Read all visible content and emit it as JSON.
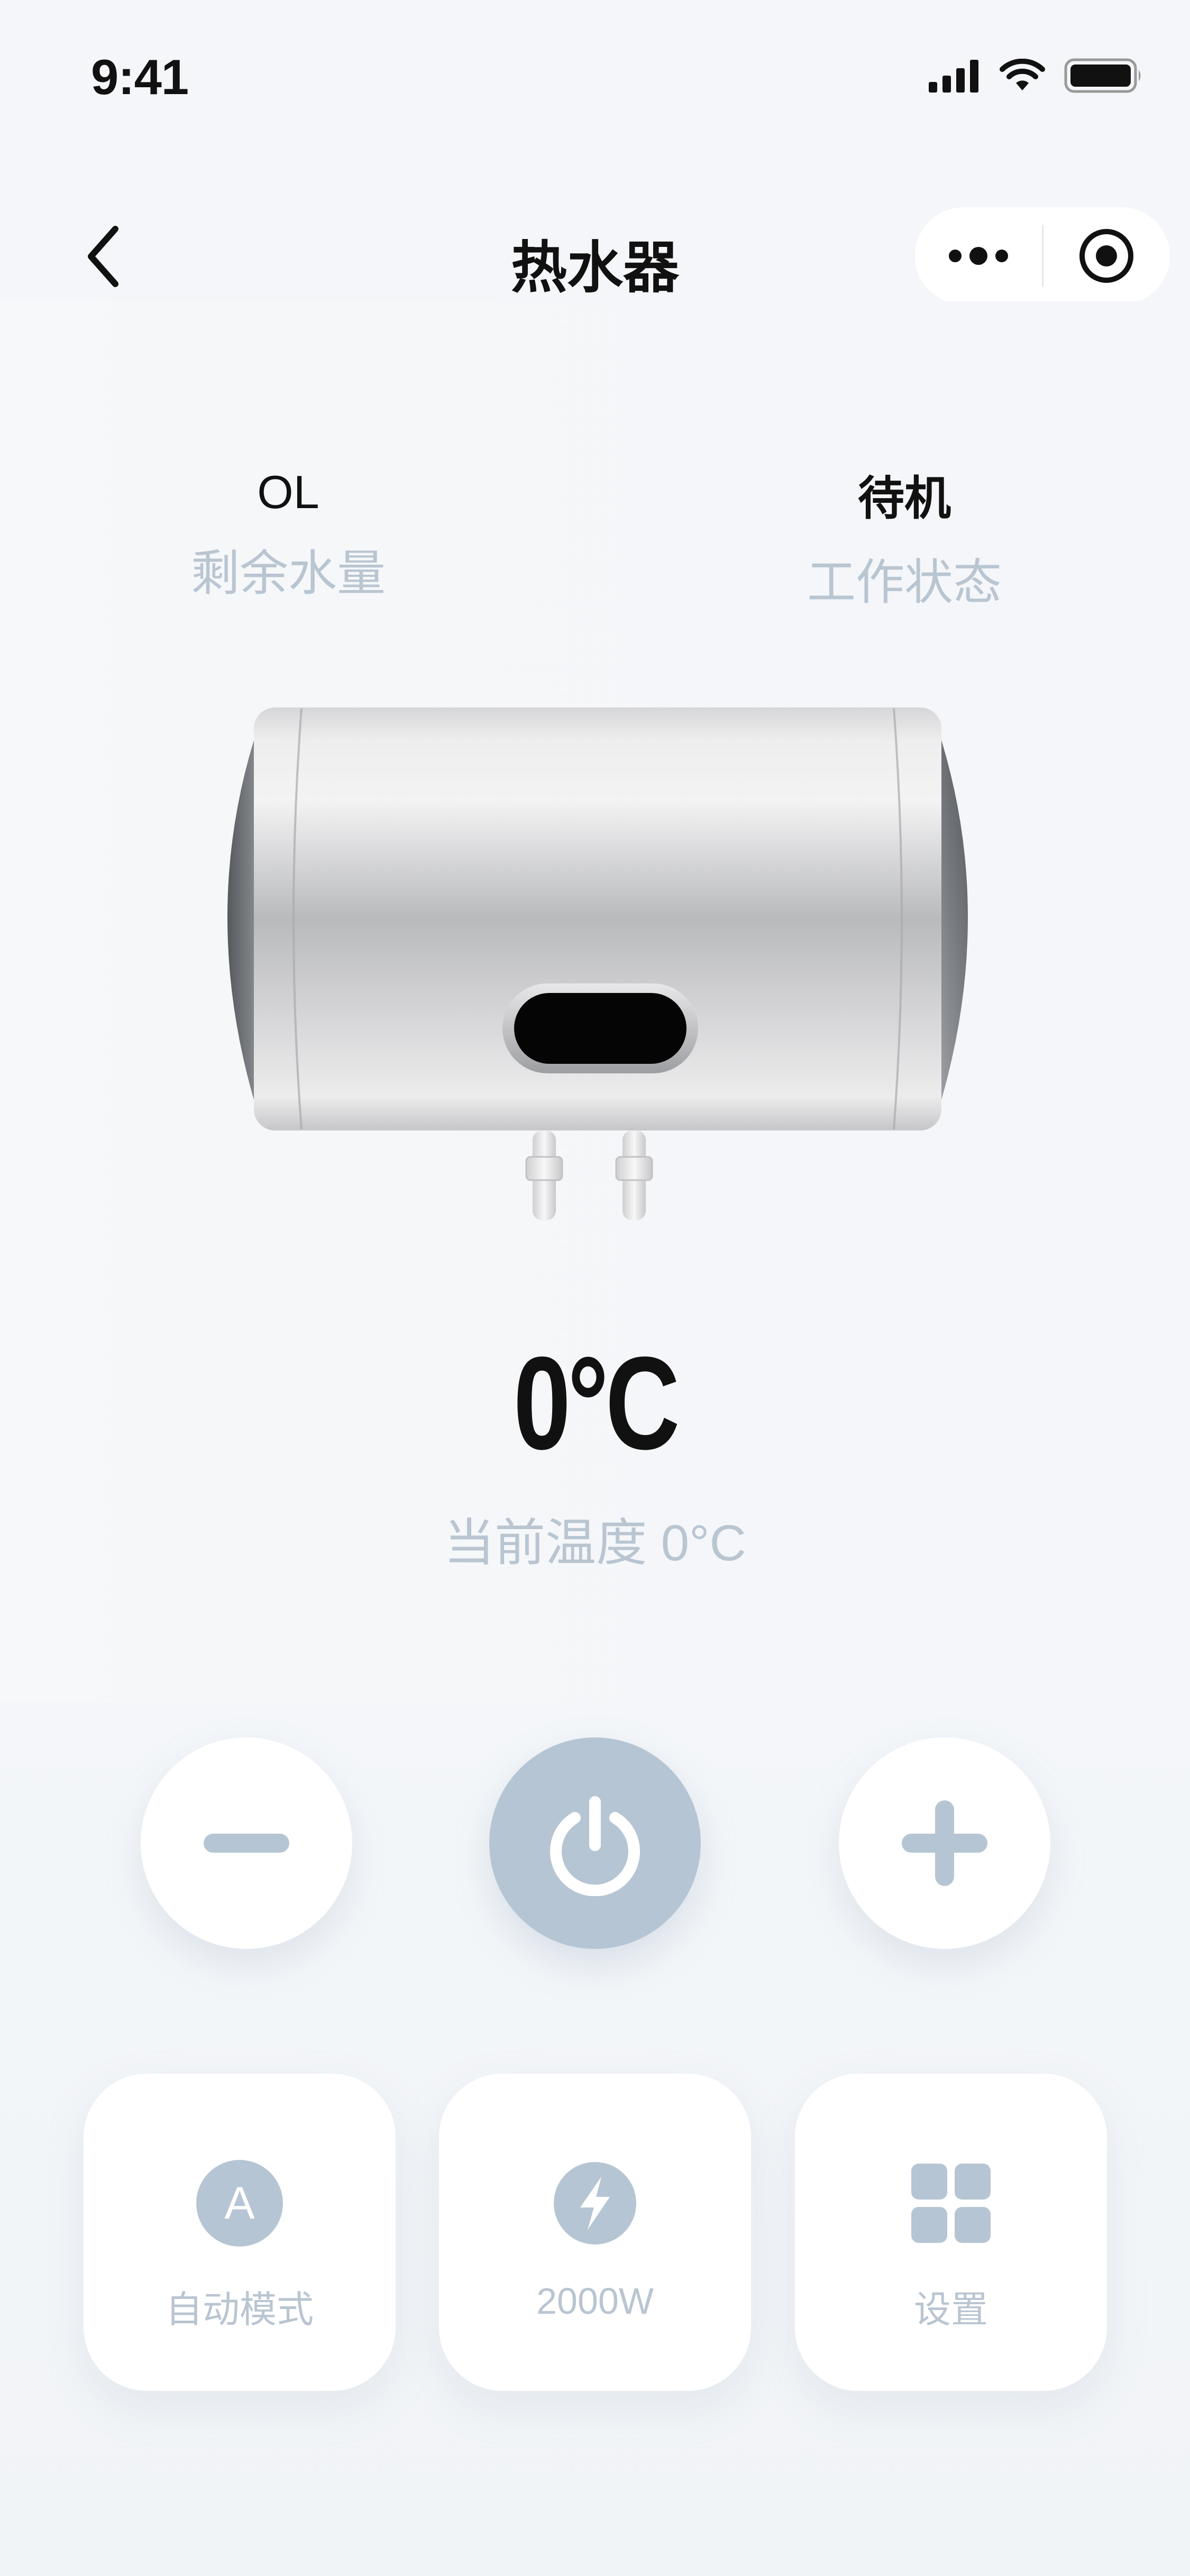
{
  "status_bar": {
    "time": "9:41"
  },
  "nav": {
    "title": "热水器",
    "back_icon": "chevron-left-icon",
    "more_icon": "more-dots-icon",
    "record_icon": "record-icon"
  },
  "stats": {
    "water": {
      "value": "OL",
      "label": "剩余水量"
    },
    "status": {
      "value": "待机",
      "label": "工作状态"
    }
  },
  "temperature": {
    "display": "0°C",
    "current_label": "当前温度 0°C"
  },
  "controls": {
    "decrease_icon": "minus-icon",
    "power_icon": "power-icon",
    "increase_icon": "plus-icon"
  },
  "cards": [
    {
      "label": "自动模式",
      "icon": "auto-mode-icon",
      "badge": "A"
    },
    {
      "label": "2000W",
      "icon": "lightning-icon"
    },
    {
      "label": "设置",
      "icon": "grid-icon"
    }
  ],
  "colors": {
    "background": "#f4f6f9",
    "accent": "#b6c5d3",
    "muted_text": "#b9c5d1",
    "text": "#111111"
  }
}
